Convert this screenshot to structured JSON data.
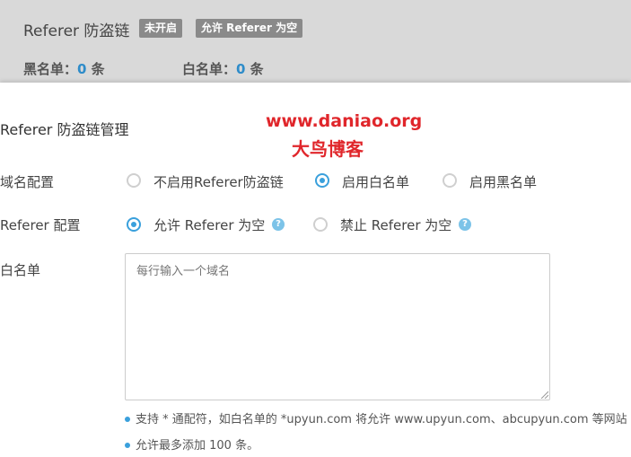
{
  "header": {
    "title": "Referer 防盗链",
    "status_badge": "未开启",
    "allow_empty_badge": "允许 Referer 为空",
    "blacklist": {
      "label": "黑名单：",
      "count": "0",
      "unit": " 条"
    },
    "whitelist": {
      "label": "白名单：",
      "count": "0",
      "unit": " 条"
    }
  },
  "watermark": {
    "url": "www.daniao.org",
    "name": "大鸟博客"
  },
  "section": {
    "title": "Referer 防盗链管理"
  },
  "domain_config": {
    "label": "域名配置",
    "options": [
      "不启用Referer防盗链",
      "启用白名单",
      "启用黑名单"
    ],
    "selected": "启用白名单"
  },
  "referer_config": {
    "label": "Referer 配置",
    "options": [
      "允许 Referer 为空",
      "禁止 Referer 为空"
    ],
    "selected": "允许 Referer 为空",
    "help_icon": "question-icon"
  },
  "whitelist_field": {
    "label": "白名单",
    "placeholder": "每行输入一个域名",
    "value": ""
  },
  "notes": [
    "支持 * 通配符，如白名单的 *upyun.com 将允许 www.upyun.com、abcupyun.com 等网站",
    "允许最多添加 100 条。"
  ],
  "colors": {
    "accent": "#3aa0dc",
    "badge": "#8a8a8a",
    "watermark": "#e0262b",
    "header_bg": "#d9d9d9"
  }
}
